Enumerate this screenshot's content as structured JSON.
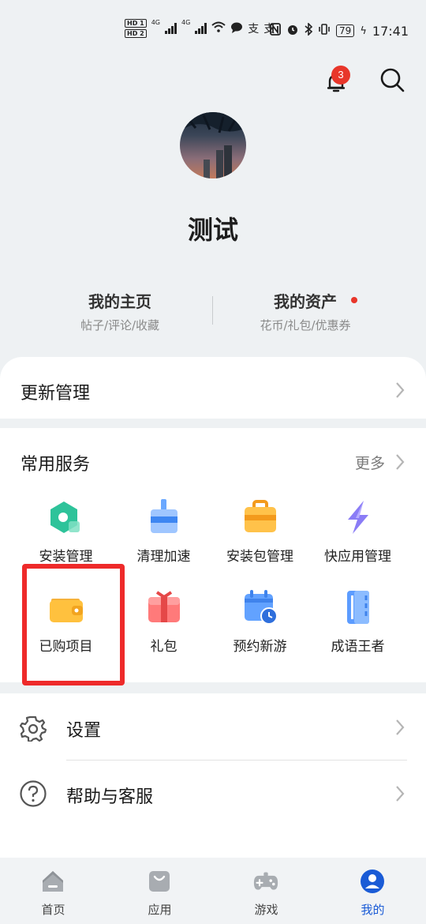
{
  "status_bar": {
    "hd1": "HD 1",
    "hd2": "HD 2",
    "net1": "4G",
    "net2": "4G",
    "battery": "79",
    "time": "17:41"
  },
  "header": {
    "notification_count": "3"
  },
  "profile": {
    "username": "测试"
  },
  "quick_links": [
    {
      "title": "我的主页",
      "subtitle": "帖子/评论/收藏"
    },
    {
      "title": "我的资产",
      "subtitle": "花币/礼包/优惠券"
    }
  ],
  "update_manager": {
    "label": "更新管理"
  },
  "services": {
    "title": "常用服务",
    "more_label": "更多",
    "items": [
      {
        "label": "安装管理",
        "icon": "install-manager-icon"
      },
      {
        "label": "清理加速",
        "icon": "clean-boost-icon"
      },
      {
        "label": "安装包管理",
        "icon": "package-manager-icon"
      },
      {
        "label": "快应用管理",
        "icon": "quick-app-icon"
      },
      {
        "label": "已购项目",
        "icon": "wallet-icon"
      },
      {
        "label": "礼包",
        "icon": "gift-icon"
      },
      {
        "label": "预约新游",
        "icon": "calendar-icon"
      },
      {
        "label": "成语王者",
        "icon": "book-icon"
      }
    ]
  },
  "settings_list": [
    {
      "label": "设置",
      "icon": "gear-icon"
    },
    {
      "label": "帮助与客服",
      "icon": "help-icon"
    }
  ],
  "bottom_nav": [
    {
      "label": "首页",
      "icon": "home-icon"
    },
    {
      "label": "应用",
      "icon": "apps-bag-icon"
    },
    {
      "label": "游戏",
      "icon": "gamepad-icon"
    },
    {
      "label": "我的",
      "icon": "profile-icon",
      "active": true
    }
  ],
  "colors": {
    "accent": "#1a5bd6",
    "badge_red": "#e8362a",
    "highlight_red": "#ee2a2a",
    "background": "#eef1f3"
  }
}
